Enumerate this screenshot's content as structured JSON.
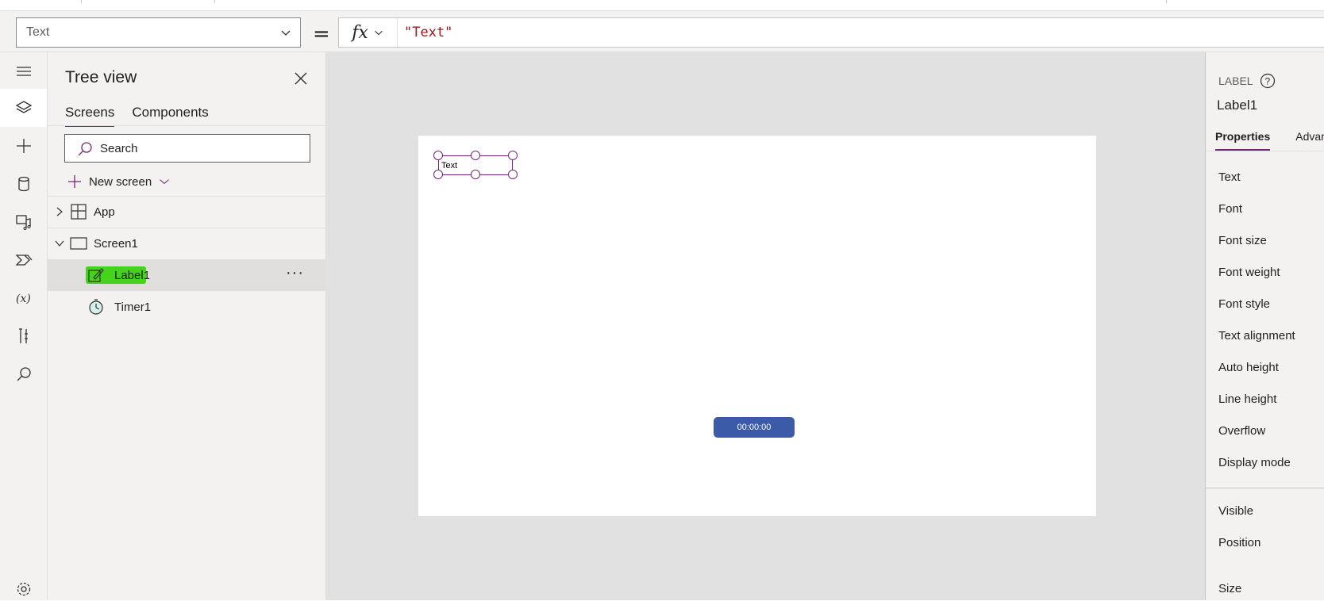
{
  "formula_bar": {
    "property": "Text",
    "equals": "=",
    "fx": "fx",
    "formula": "\"Text\""
  },
  "rail": {
    "items": [
      "hamburger-menu",
      "tree-view",
      "insert",
      "data",
      "media",
      "power-automate",
      "variables",
      "advanced-tools",
      "search",
      "settings"
    ]
  },
  "tree_view": {
    "title": "Tree view",
    "tabs": [
      "Screens",
      "Components"
    ],
    "search_placeholder": "Search",
    "new_screen": "New screen",
    "nodes": {
      "app": "App",
      "screen1": "Screen1",
      "label1": "Label1",
      "timer1": "Timer1"
    },
    "more": "···"
  },
  "canvas": {
    "label_text": "Text",
    "timer_text": "00:00:00"
  },
  "properties_panel": {
    "kind": "LABEL",
    "name": "Label1",
    "tabs": [
      "Properties",
      "Advan"
    ],
    "rows": [
      "Text",
      "Font",
      "Font size",
      "Font weight",
      "Font style",
      "Text alignment",
      "Auto height",
      "Line height",
      "Overflow",
      "Display mode"
    ],
    "rows2": [
      "Visible",
      "Position",
      "Size"
    ]
  },
  "colors": {
    "accent": "#742774",
    "timer_fill": "#3b5ba9",
    "highlight": "#44d41b"
  }
}
